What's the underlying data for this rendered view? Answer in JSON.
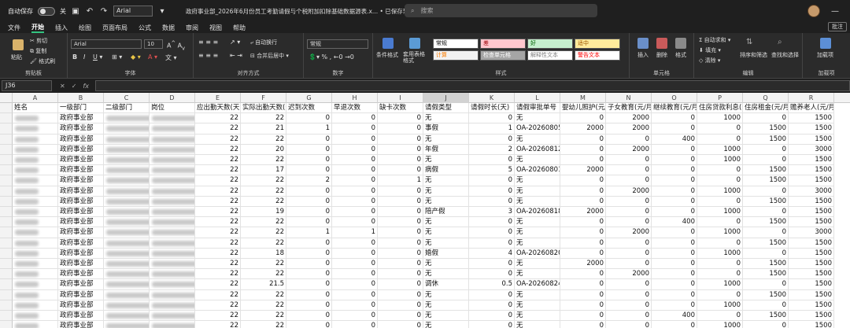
{
  "titlebar": {
    "autosave_label": "自动保存",
    "autosave_state": "关",
    "font_name": "Arial",
    "file_title": "政府事业部_2026年6月份员工考勤请假与个税附加扣除基础数据源表.x... • 已保存到这台电脑",
    "search_placeholder": "搜索"
  },
  "menu": {
    "tabs": [
      "文件",
      "开始",
      "插入",
      "绘图",
      "页面布局",
      "公式",
      "数据",
      "审阅",
      "视图",
      "帮助"
    ],
    "active": "开始",
    "comment_label": "批注"
  },
  "ribbon": {
    "clipboard": {
      "paste": "粘贴",
      "cut": "剪切",
      "copy": "复制",
      "format_painter": "格式刷",
      "label": "剪贴板"
    },
    "font": {
      "name": "Arial",
      "size": "10",
      "label": "字体"
    },
    "alignment": {
      "wrap": "自动换行",
      "merge": "合并后居中",
      "label": "对齐方式"
    },
    "number": {
      "format": "常规",
      "label": "数字"
    },
    "styles": {
      "conditional": "条件格式",
      "table": "套用表格格式",
      "cells": [
        {
          "text": "常规",
          "bg": "#ffffff",
          "fg": "#000000"
        },
        {
          "text": "差",
          "bg": "#ffc7ce",
          "fg": "#9c0006"
        },
        {
          "text": "好",
          "bg": "#c6efce",
          "fg": "#006100"
        },
        {
          "text": "适中",
          "bg": "#ffeb9c",
          "fg": "#9c5700"
        },
        {
          "text": "计算",
          "bg": "#f2f2f2",
          "fg": "#fa7d00"
        },
        {
          "text": "检查单元格",
          "bg": "#a5a5a5",
          "fg": "#ffffff"
        },
        {
          "text": "解释性文本",
          "bg": "#ffffff",
          "fg": "#7f7f7f"
        },
        {
          "text": "警告文本",
          "bg": "#ffffff",
          "fg": "#ff0000"
        }
      ],
      "label": "样式"
    },
    "cells_grp": {
      "insert": "插入",
      "delete": "删除",
      "format": "格式",
      "label": "单元格"
    },
    "editing": {
      "autosum": "自动求和",
      "fill": "填充",
      "clear": "清除",
      "sort": "排序和筛选",
      "find": "查找和选择",
      "label": "编辑"
    },
    "addins": {
      "add": "加载项",
      "label": "加载项"
    }
  },
  "formula_bar": {
    "name_box": "J36",
    "fx": "fx",
    "value": ""
  },
  "columns": [
    "A",
    "B",
    "C",
    "D",
    "E",
    "F",
    "G",
    "H",
    "I",
    "J",
    "K",
    "L",
    "M",
    "N",
    "O",
    "P",
    "Q",
    "R",
    "S"
  ],
  "selected_column": "J",
  "header_row": [
    "姓名",
    "一级部门",
    "二级部门",
    "岗位",
    "应出勤天数(天)",
    "实际出勤天数(天",
    "迟到次数",
    "早退次数",
    "缺卡次数",
    "请假类型",
    "请假时长(天)",
    "请假审批单号",
    "婴幼儿照护(元/",
    "子女教育(元/月",
    "继续教育(元/月",
    "住房贷款利息(元",
    "住房租金(元/月",
    "赡养老人(元/月"
  ],
  "rows": [
    [
      "",
      "政府事业部",
      "",
      "",
      "22",
      "22",
      "0",
      "0",
      "0",
      "无",
      "0",
      "无",
      "0",
      "2000",
      "0",
      "1000",
      "0",
      "1500"
    ],
    [
      "",
      "政府事业部",
      "",
      "",
      "22",
      "21",
      "1",
      "0",
      "0",
      "事假",
      "1",
      "OA-20260805-",
      "2000",
      "2000",
      "0",
      "0",
      "1500",
      "1500"
    ],
    [
      "",
      "政府事业部",
      "",
      "",
      "22",
      "22",
      "0",
      "0",
      "0",
      "无",
      "0",
      "无",
      "0",
      "0",
      "400",
      "0",
      "1500",
      "1500"
    ],
    [
      "",
      "政府事业部",
      "",
      "",
      "22",
      "20",
      "0",
      "0",
      "0",
      "年假",
      "2",
      "OA-20260812-",
      "0",
      "2000",
      "0",
      "1000",
      "0",
      "3000"
    ],
    [
      "",
      "政府事业部",
      "",
      "",
      "22",
      "22",
      "0",
      "0",
      "0",
      "无",
      "0",
      "无",
      "0",
      "0",
      "0",
      "1000",
      "0",
      "1500"
    ],
    [
      "",
      "政府事业部",
      "",
      "",
      "22",
      "17",
      "0",
      "0",
      "0",
      "病假",
      "5",
      "OA-20260801-",
      "2000",
      "0",
      "0",
      "0",
      "1500",
      "1500"
    ],
    [
      "",
      "政府事业部",
      "",
      "",
      "22",
      "22",
      "2",
      "0",
      "1",
      "无",
      "0",
      "无",
      "0",
      "0",
      "0",
      "0",
      "1500",
      "1500"
    ],
    [
      "",
      "政府事业部",
      "",
      "",
      "22",
      "22",
      "0",
      "0",
      "0",
      "无",
      "0",
      "无",
      "0",
      "2000",
      "0",
      "1000",
      "0",
      "3000"
    ],
    [
      "",
      "政府事业部",
      "",
      "",
      "22",
      "22",
      "0",
      "0",
      "0",
      "无",
      "0",
      "无",
      "0",
      "0",
      "0",
      "0",
      "1500",
      "1500"
    ],
    [
      "",
      "政府事业部",
      "",
      "",
      "22",
      "19",
      "0",
      "0",
      "0",
      "陪产假",
      "3",
      "OA-20260818-",
      "2000",
      "0",
      "0",
      "1000",
      "0",
      "1500"
    ],
    [
      "",
      "政府事业部",
      "",
      "",
      "22",
      "22",
      "0",
      "0",
      "0",
      "无",
      "0",
      "无",
      "0",
      "0",
      "400",
      "0",
      "1500",
      "1500"
    ],
    [
      "",
      "政府事业部",
      "",
      "",
      "22",
      "22",
      "1",
      "1",
      "0",
      "无",
      "0",
      "无",
      "0",
      "2000",
      "0",
      "1000",
      "0",
      "3000"
    ],
    [
      "",
      "政府事业部",
      "",
      "",
      "22",
      "22",
      "0",
      "0",
      "0",
      "无",
      "0",
      "无",
      "0",
      "0",
      "0",
      "0",
      "1500",
      "1500"
    ],
    [
      "",
      "政府事业部",
      "",
      "",
      "22",
      "18",
      "0",
      "0",
      "0",
      "婚假",
      "4",
      "OA-20260820-",
      "0",
      "0",
      "0",
      "1000",
      "0",
      "1500"
    ],
    [
      "",
      "政府事业部",
      "",
      "",
      "22",
      "22",
      "0",
      "0",
      "0",
      "无",
      "0",
      "无",
      "2000",
      "0",
      "0",
      "0",
      "1500",
      "1500"
    ],
    [
      "",
      "政府事业部",
      "",
      "",
      "22",
      "22",
      "0",
      "0",
      "0",
      "无",
      "0",
      "无",
      "0",
      "2000",
      "0",
      "0",
      "1500",
      "1500"
    ],
    [
      "",
      "政府事业部",
      "",
      "",
      "22",
      "21.5",
      "0",
      "0",
      "0",
      "调休",
      "0.5",
      "OA-20260824-",
      "0",
      "0",
      "0",
      "1000",
      "0",
      "1500"
    ],
    [
      "",
      "政府事业部",
      "",
      "",
      "22",
      "22",
      "0",
      "0",
      "0",
      "无",
      "0",
      "无",
      "0",
      "0",
      "0",
      "0",
      "1500",
      "1500"
    ],
    [
      "",
      "政府事业部",
      "",
      "",
      "22",
      "22",
      "0",
      "0",
      "0",
      "无",
      "0",
      "无",
      "0",
      "0",
      "0",
      "1000",
      "0",
      "1500"
    ],
    [
      "",
      "政府事业部",
      "",
      "",
      "22",
      "22",
      "0",
      "0",
      "0",
      "无",
      "0",
      "无",
      "0",
      "0",
      "400",
      "0",
      "1500",
      "1500"
    ],
    [
      "",
      "政府事业部",
      "",
      "",
      "22",
      "22",
      "0",
      "0",
      "0",
      "无",
      "0",
      "无",
      "0",
      "0",
      "0",
      "1000",
      "0",
      "1500"
    ]
  ],
  "row_numbers": [
    "1",
    "2",
    "3",
    "4",
    "5",
    "6",
    "7",
    "8",
    "9",
    "10",
    "11",
    "12",
    "13",
    "14",
    "15",
    "16",
    "17",
    "18",
    "19",
    "20",
    "21",
    "22"
  ]
}
